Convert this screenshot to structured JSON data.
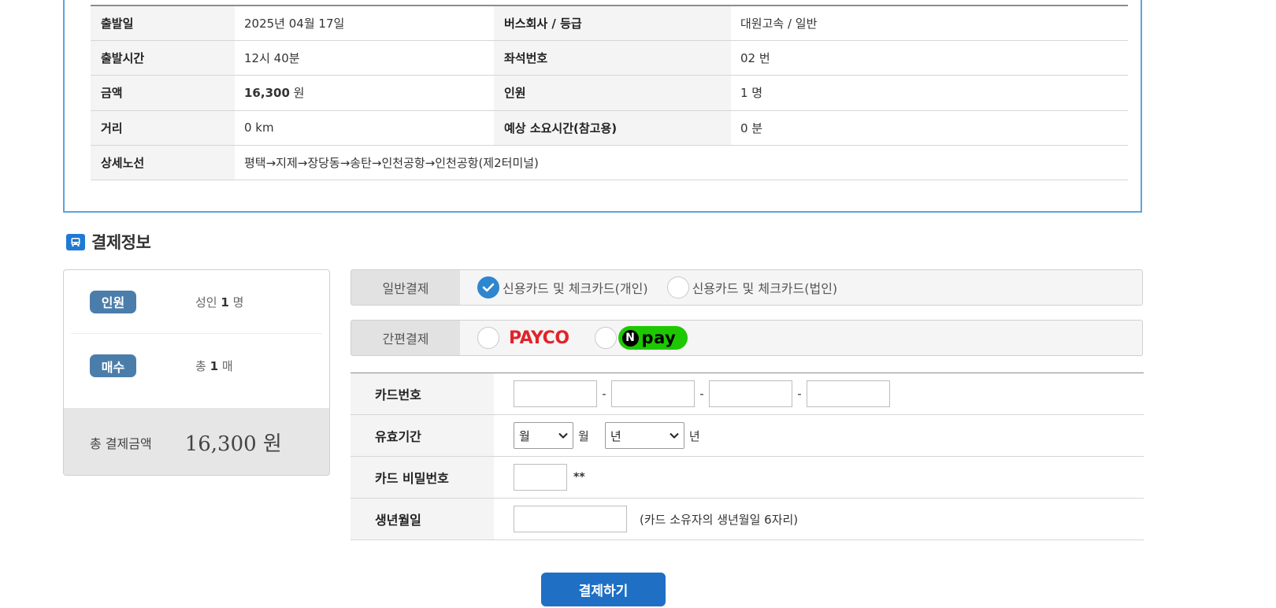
{
  "ticket": {
    "rows": [
      {
        "label1": "출발일",
        "value1": "2025년 04월 17일",
        "label2": "버스회사 / 등급",
        "value2": "대원고속 / 일반"
      },
      {
        "label1": "출발시간",
        "value1": "12시 40분",
        "label2": "좌석번호",
        "value2": "02 번"
      },
      {
        "label1": "금액",
        "value1_amount": "16,300",
        "value1_unit": "원",
        "label2": "인원",
        "value2": "1 명"
      },
      {
        "label1": "거리",
        "value1": "0 km",
        "label2": "예상 소요시간(참고용)",
        "value2": "0 분"
      }
    ],
    "route": {
      "label": "상세노선",
      "value": "평택→지제→장당동→송탄→인천공항→인천공항(제2터미널)"
    }
  },
  "section": {
    "title": "결제정보",
    "icon": "bus-icon"
  },
  "summary": {
    "people": {
      "badge": "인원",
      "prefix": "성인",
      "count": "1",
      "unit": "명"
    },
    "tickets": {
      "badge": "매수",
      "prefix": "총",
      "count": "1",
      "unit": "매"
    },
    "total": {
      "label": "총 결제금액",
      "amount": "16,300 원"
    }
  },
  "payment": {
    "general": {
      "label": "일반결제",
      "options": [
        "신용카드 및 체크카드(개인)",
        "신용카드 및 체크카드(법인)"
      ],
      "selected": 0
    },
    "easy": {
      "label": "간편결제",
      "payco": "PAYCO",
      "npay_n": "N",
      "npay": "pay"
    }
  },
  "card_form": {
    "card_number_label": "카드번호",
    "card_number_separator": "-",
    "expiry_label": "유효기간",
    "month_select": "월",
    "month_unit": "월",
    "year_select": "년",
    "year_unit": "년",
    "password_label": "카드 비밀번호",
    "password_note": "**",
    "birth_label": "생년월일",
    "birth_note": "(카드 소유자의 생년월일 6자리)"
  },
  "submit_label": "결제하기",
  "colors": {
    "accent": "#1f6fc4",
    "badge": "#4b7dab",
    "checked": "#2e86cf",
    "payco": "#e2232a",
    "npay": "#1ec800",
    "box_border": "#5aa4e0"
  }
}
